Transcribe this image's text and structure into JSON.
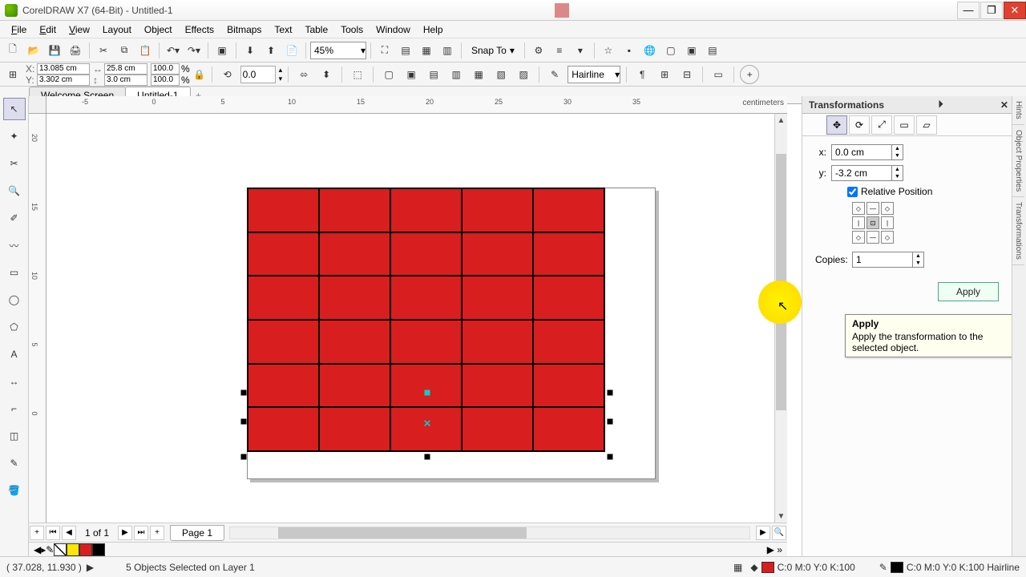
{
  "window": {
    "title": "CorelDRAW X7 (64-Bit) - Untitled-1"
  },
  "menu": {
    "file": "File",
    "edit": "Edit",
    "view": "View",
    "layout": "Layout",
    "object": "Object",
    "effects": "Effects",
    "bitmaps": "Bitmaps",
    "text": "Text",
    "table": "Table",
    "tools": "Tools",
    "window": "Window",
    "help": "Help"
  },
  "toolbar1": {
    "zoom": "45%",
    "snap": "Snap To"
  },
  "propbar": {
    "x": "13.085 cm",
    "y": "3.302 cm",
    "w": "25.8 cm",
    "h": "3.0 cm",
    "sx": "100.0",
    "sy": "100.0",
    "angle": "0.0",
    "outline": "Hairline"
  },
  "tabs": {
    "welcome": "Welcome Screen",
    "doc": "Untitled-1"
  },
  "ruler": {
    "units": "centimeters"
  },
  "pagenav": {
    "counter": "1 of 1",
    "pagetab": "Page 1"
  },
  "status": {
    "coords": "( 37.028, 11.930 )",
    "selection": "5 Objects Selected on Layer 1",
    "fill": "C:0 M:0 Y:0 K:100",
    "outline": "C:0 M:0 Y:0 K:100  Hairline"
  },
  "docker": {
    "title": "Transformations",
    "x_label": "x:",
    "x_val": "0.0 cm",
    "y_label": "y:",
    "y_val": "-3.2 cm",
    "relpos": "Relative Position",
    "copies_label": "Copies:",
    "copies_val": "1",
    "apply": "Apply"
  },
  "tooltip": {
    "title": "Apply",
    "body": "Apply the transformation to the selected object."
  },
  "rightstrip": {
    "hints": "Hints",
    "objprops": "Object Properties",
    "transforms": "Transformations"
  },
  "grid": {
    "rows": 6,
    "cols": 5
  },
  "ruler_h_ticks": [
    -5,
    0,
    5,
    10,
    15,
    20,
    25,
    30,
    35
  ],
  "ruler_v_ticks": [
    20,
    15,
    10,
    5,
    0
  ]
}
